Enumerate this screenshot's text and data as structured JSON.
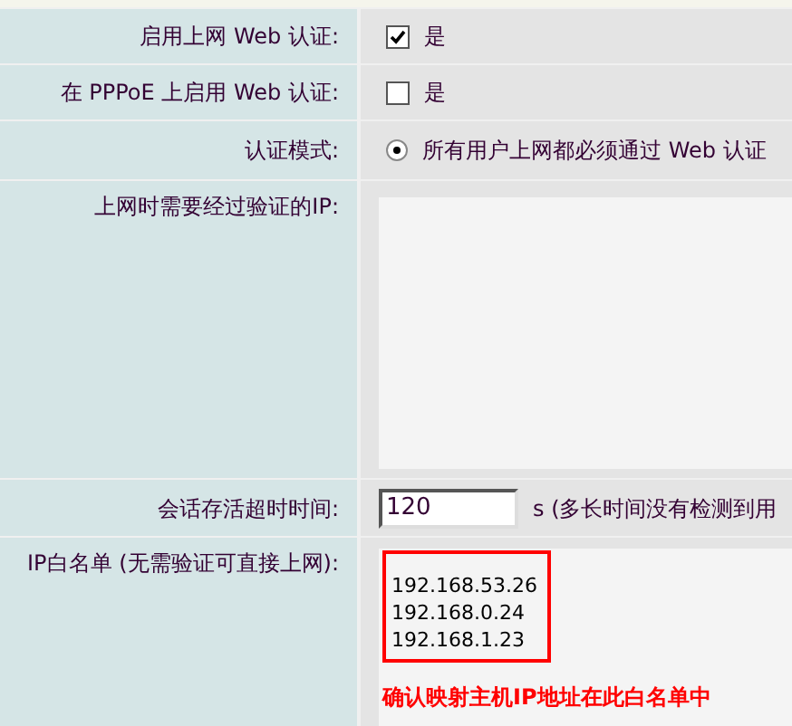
{
  "rows": [
    {
      "kind": "checkbox",
      "label": "启用上网 Web 认证:",
      "option": "是",
      "checked": true
    },
    {
      "kind": "checkbox",
      "label": "在 PPPoE 上启用 Web 认证:",
      "option": "是",
      "checked": false
    },
    {
      "kind": "radio",
      "label": "认证模式:",
      "option": "所有用户上网都必须通过 Web 认证",
      "selected": true
    },
    {
      "kind": "textarea",
      "label": "上网时需要经过验证的IP:"
    },
    {
      "kind": "input",
      "label": "会话存活超时时间:",
      "value": "120",
      "suffix": "s (多长时间没有检测到用"
    },
    {
      "kind": "whitelist",
      "label": "IP白名单 (无需验证可直接上网):",
      "lines": [
        "192.168.53.26",
        "192.168.0.24",
        "192.168.1.23"
      ]
    }
  ],
  "annotation": "确认映射主机IP地址在此白名单中"
}
